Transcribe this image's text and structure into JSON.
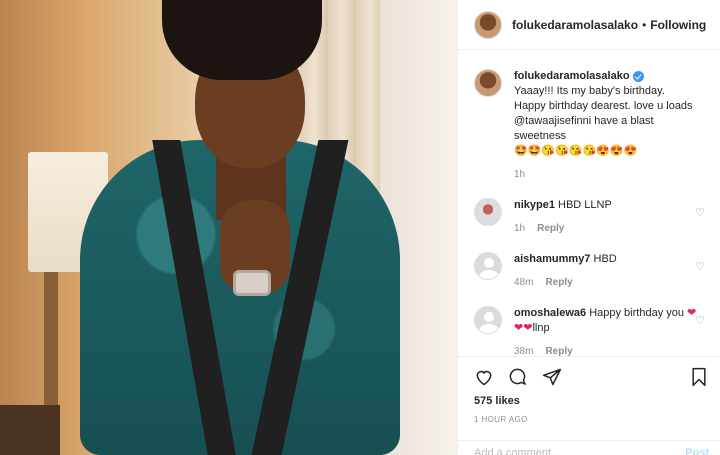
{
  "post": {
    "username": "folukedaramolasalako",
    "follow_sep": "•",
    "follow_label": "Following"
  },
  "caption": {
    "username": "folukedaramolasalako",
    "text": "Yaaay!!! Its my baby's birthday. Happy birthday dearest. love u loads @tawaajisefinni have a blast sweetness",
    "emojis": "🤩🤩😘😘😘😘😍😍😍",
    "time": "1h"
  },
  "comments": [
    {
      "username": "nikype1",
      "text": "HBD LLNP",
      "time": "1h",
      "reply": "Reply"
    },
    {
      "username": "aishamummy7",
      "text": "HBD",
      "time": "48m",
      "reply": "Reply"
    },
    {
      "username": "omoshalewa6",
      "text": "Happy birthday you",
      "hearts": "❤❤❤",
      "suffix": "llnp",
      "time": "38m",
      "reply": "Reply"
    }
  ],
  "footer": {
    "likes": "575 likes",
    "time_ago": "1 HOUR AGO",
    "add_comment_placeholder": "Add a comment...",
    "post_label": "Post"
  },
  "icons": [
    "heart-icon",
    "comment-icon",
    "share-icon",
    "bookmark-icon"
  ],
  "colors": {
    "verified": "#3897f0",
    "border": "#efefef",
    "muted": "#8e8e8e"
  }
}
